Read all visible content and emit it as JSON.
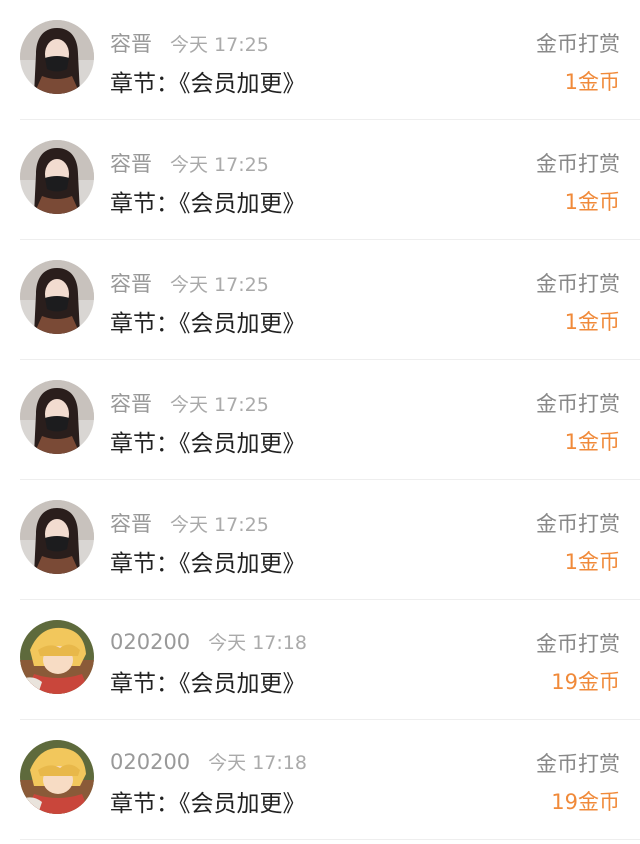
{
  "rewards": [
    {
      "user": "容晋",
      "time": "今天 17:25",
      "chapter": "章节：《会员加更》",
      "type": "金币打赏",
      "amount": "1金币",
      "avatar_icon": "woman-mask-avatar"
    },
    {
      "user": "容晋",
      "time": "今天 17:25",
      "chapter": "章节：《会员加更》",
      "type": "金币打赏",
      "amount": "1金币",
      "avatar_icon": "woman-mask-avatar"
    },
    {
      "user": "容晋",
      "time": "今天 17:25",
      "chapter": "章节：《会员加更》",
      "type": "金币打赏",
      "amount": "1金币",
      "avatar_icon": "woman-mask-avatar"
    },
    {
      "user": "容晋",
      "time": "今天 17:25",
      "chapter": "章节：《会员加更》",
      "type": "金币打赏",
      "amount": "1金币",
      "avatar_icon": "woman-mask-avatar"
    },
    {
      "user": "容晋",
      "time": "今天 17:25",
      "chapter": "章节：《会员加更》",
      "type": "金币打赏",
      "amount": "1金币",
      "avatar_icon": "woman-mask-avatar"
    },
    {
      "user": "020200",
      "time": "今天 17:18",
      "chapter": "章节：《会员加更》",
      "type": "金币打赏",
      "amount": "19金币",
      "avatar_icon": "anime-character-avatar"
    },
    {
      "user": "020200",
      "time": "今天 17:18",
      "chapter": "章节：《会员加更》",
      "type": "金币打赏",
      "amount": "19金币",
      "avatar_icon": "anime-character-avatar"
    }
  ],
  "colors": {
    "amount": "#f08a3a",
    "meta": "#999999",
    "chapter": "#222222",
    "divider": "#eeeeee"
  }
}
